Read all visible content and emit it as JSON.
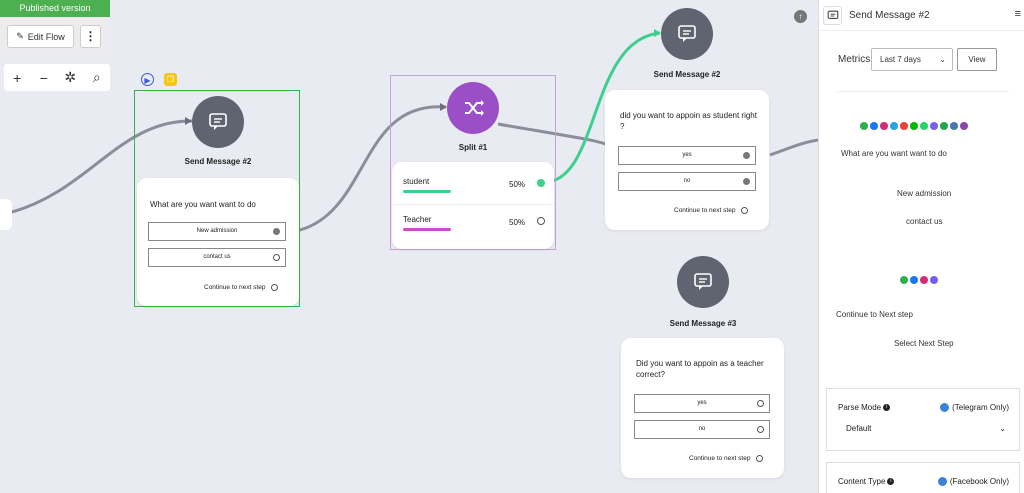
{
  "toolbar": {
    "published_label": "Published version",
    "edit_flow_label": "Edit Flow",
    "more_label": "⋮",
    "zoom_in": "+",
    "zoom_out": "−",
    "magic": "✲",
    "search": "⌕"
  },
  "nodes": {
    "send1": {
      "title": "Send Message #2",
      "question": "What are you want want to do",
      "options": [
        "New admission",
        "contact us"
      ],
      "next_step": "Continue to next step"
    },
    "split": {
      "title": "Split #1",
      "rows": [
        {
          "label": "student",
          "percent": "50%",
          "color": "#3ecf8e"
        },
        {
          "label": "Teacher",
          "percent": "50%",
          "color": "#c94fcf"
        }
      ]
    },
    "send2": {
      "title": "Send Message #2",
      "question": "did you want to appoin as student right ?",
      "options": [
        "yes",
        "no"
      ],
      "next_step": "Continue to next step"
    },
    "send3": {
      "title": "Send Message #3",
      "question": "Did you want to appoin as a teacher correct?",
      "options": [
        "yes",
        "no"
      ],
      "next_step": "Continue to next step"
    }
  },
  "panel": {
    "title": "Send Message #2",
    "menu": "≡",
    "metrics_label": "Metrics",
    "period_value": "Last 7 days",
    "view_button": "View",
    "question": "What are you want want to do",
    "option1": "New admission",
    "option2": "contact us",
    "continue_label": "Continue to Next step",
    "select_next_step": "Select Next Step",
    "parse_mode_label": "Parse Mode",
    "parse_mode_note": "(Telegram Only)",
    "parse_mode_value": "Default",
    "content_type_label": "Content Type",
    "content_type_note": "(Facebook Only)"
  },
  "colors": {
    "accent_green": "#3cb043",
    "split_purple": "#9b4fc7",
    "edge_teal": "#3ecf8e",
    "edge_gray": "#8a8e9a"
  }
}
